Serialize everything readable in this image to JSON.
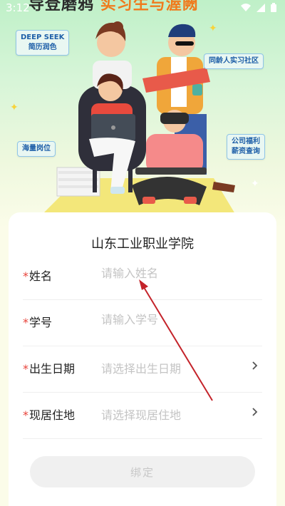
{
  "status_bar": {
    "time": "3:12"
  },
  "banner": {
    "headline_left": "导登",
    "headline_mid": "磨鸦",
    "headline_right": "实习生与渥阙",
    "tags": [
      "DEEP SEEK",
      "简历润色",
      "同龄人实习社区",
      "海量岗位",
      "公司福利",
      "薪资查询"
    ]
  },
  "form": {
    "title": "山东工业职业学院",
    "required_mark": "*",
    "fields": [
      {
        "label": "姓名",
        "placeholder": "请输入姓名"
      },
      {
        "label": "学号",
        "placeholder": "请输入学号"
      },
      {
        "label": "出生日期",
        "placeholder": "请选择出生日期"
      },
      {
        "label": "现居住地",
        "placeholder": "请选择现居住地"
      }
    ],
    "submit_label": "绑定"
  },
  "colors": {
    "accent_red": "#e8433a",
    "annotation_arrow": "#c4232a",
    "card_bg": "#ffffff"
  }
}
